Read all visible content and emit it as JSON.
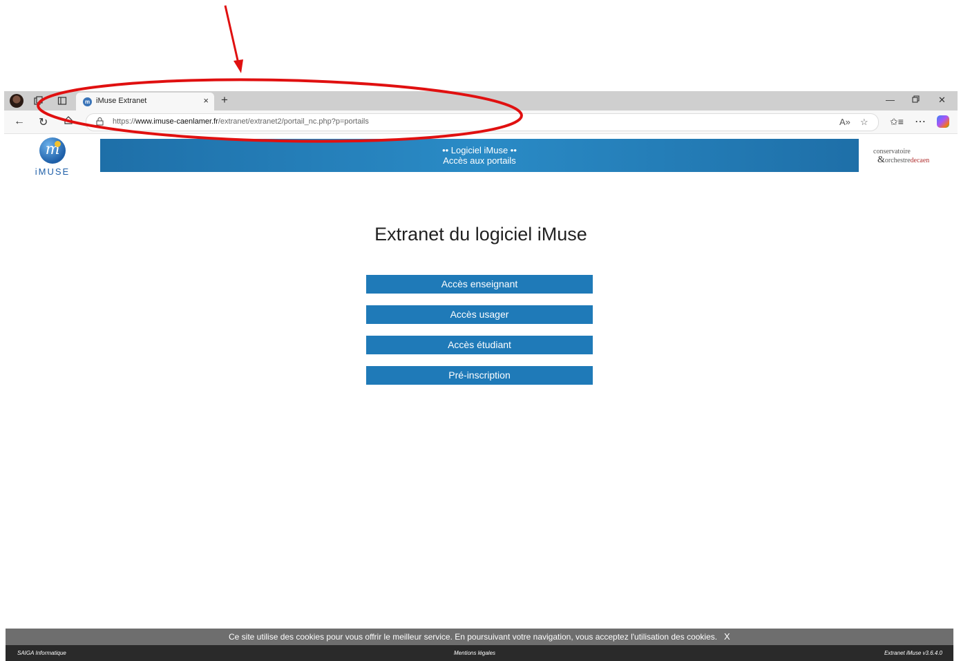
{
  "browser": {
    "tab_title": "iMuse Extranet",
    "tab_favicon": "imuse-favicon",
    "tab_close_glyph": "×",
    "new_tab_glyph": "+",
    "url_prefix": "https://",
    "url_domain": "www.imuse-caenlamer.fr",
    "url_path": "/extranet/extranet2/portail_nc.php?p=portails",
    "icons": [
      "profile-avatar-icon",
      "workspaces-icon",
      "tab-actions-icon",
      "back-icon",
      "refresh-icon",
      "home-icon",
      "site-info-icon",
      "read-aloud-icon",
      "favorite-star-icon",
      "favorites-icon",
      "more-icon",
      "copilot-icon"
    ],
    "window_controls": [
      "minimize-icon",
      "restore-icon",
      "close-icon"
    ]
  },
  "header": {
    "logo_text": "iMUSE",
    "banner_line1": "•• Logiciel iMuse ••",
    "banner_line2": "Accès aux portails",
    "partner_line1": "conservatoire",
    "partner_amp": "&",
    "partner_line2a": "orchestre",
    "partner_line2b": "decaen"
  },
  "main": {
    "title": "Extranet du logiciel iMuse",
    "buttons": [
      {
        "label": "Accès enseignant"
      },
      {
        "label": "Accès usager"
      },
      {
        "label": "Accès étudiant"
      },
      {
        "label": "Pré-inscription"
      }
    ]
  },
  "cookie_banner": {
    "text": "Ce site utilise des cookies pour vous offrir le meilleur service. En poursuivant votre navigation, vous acceptez l'utilisation des cookies.",
    "close_label": "X"
  },
  "footer": {
    "left": "SAIGA Informatique",
    "center": "Mentions légales",
    "right": "Extranet iMuse v3.6.4.0"
  },
  "colors": {
    "annotation": "#e01010",
    "banner": "#2a8bc6",
    "button": "#1f7ab8",
    "cookie_bar": "#6e6e6e",
    "footer": "#2a2a2a"
  }
}
